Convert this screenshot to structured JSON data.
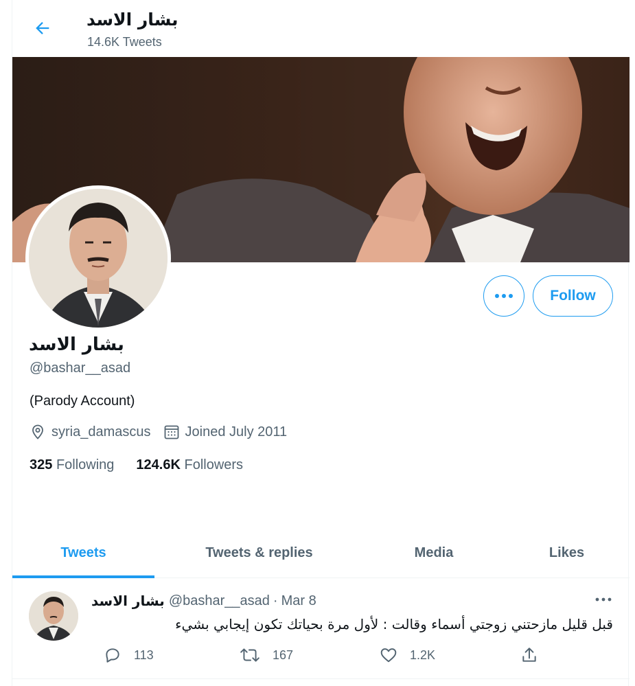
{
  "header": {
    "name": "بشار الاسد",
    "tweet_count": "14.6K Tweets"
  },
  "profile": {
    "name": "بشار الاسد",
    "handle": "@bashar__asad",
    "bio": "(Parody Account)",
    "location": "syria_damascus",
    "joined": "Joined July 2011",
    "following_count": "325",
    "following_label": "Following",
    "followers_count": "124.6K",
    "followers_label": "Followers",
    "follow_label": "Follow"
  },
  "tabs": [
    {
      "label": "Tweets",
      "active": true
    },
    {
      "label": "Tweets & replies",
      "active": false
    },
    {
      "label": "Media",
      "active": false
    },
    {
      "label": "Likes",
      "active": false
    }
  ],
  "tweet": {
    "name": "بشار الاسد",
    "handle": "@bashar__asad",
    "dot": "·",
    "time": "Mar 8",
    "text": "قبل قليل مازحتني زوجتي أسماء وقالت : لأول مرة بحياتك تكون إيجابي بشيء",
    "replies": "113",
    "retweets": "167",
    "likes": "1.2K"
  },
  "colors": {
    "accent": "#1d9bf0",
    "secondary_text": "#536471",
    "primary_text": "#0f1419",
    "border": "#eff3f4"
  },
  "icons": {
    "back": "arrow-left-icon",
    "more": "more-horizontal-icon",
    "location": "location-pin-icon",
    "calendar": "calendar-icon",
    "reply": "reply-icon",
    "retweet": "retweet-icon",
    "like": "heart-icon",
    "share": "share-icon"
  }
}
